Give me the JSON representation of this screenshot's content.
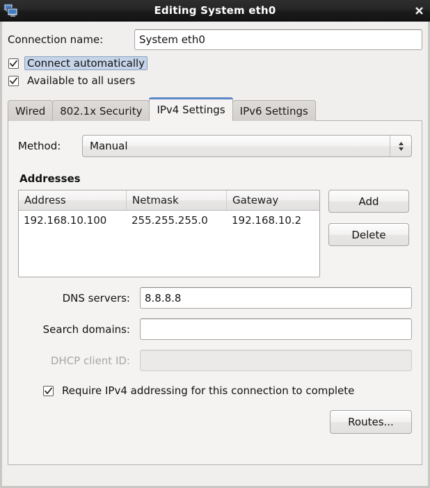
{
  "window": {
    "title": "Editing System eth0",
    "icon": "network-connection-icon",
    "close_label": "✖"
  },
  "connection": {
    "name_label": "Connection name:",
    "name_value": "System eth0",
    "name_placeholder": ""
  },
  "options": {
    "connect_automatically": {
      "label": "Connect automatically",
      "checked": "✓",
      "focused": true
    },
    "available_all_users": {
      "label": "Available to all users",
      "checked": "✓"
    }
  },
  "tabs": [
    {
      "label": "Wired",
      "active": false
    },
    {
      "label": "802.1x Security",
      "active": false
    },
    {
      "label": "IPv4 Settings",
      "active": true
    },
    {
      "label": "IPv6 Settings",
      "active": false
    }
  ],
  "ipv4": {
    "method_label": "Method:",
    "method_value": "Manual",
    "addresses_title": "Addresses",
    "table": {
      "columns": [
        "Address",
        "Netmask",
        "Gateway"
      ],
      "rows": [
        [
          "192.168.10.100",
          "255.255.255.0",
          "192.168.10.2"
        ]
      ]
    },
    "add_label": "Add",
    "delete_label": "Delete",
    "dns_label": "DNS servers:",
    "dns_value": "8.8.8.8",
    "search_label": "Search domains:",
    "search_value": "",
    "dhcp_label": "DHCP client ID:",
    "dhcp_value": "",
    "dhcp_disabled": true,
    "require_label": "Require IPv4 addressing for this connection to complete",
    "require_checked": "✓",
    "routes_label": "Routes..."
  },
  "colors": {
    "accent": "#5b87c7",
    "titlebar": "#1b1b1b",
    "background": "#f0efee",
    "panel": "#f4f3f2",
    "focus_highlight": "#c5d4e8"
  }
}
